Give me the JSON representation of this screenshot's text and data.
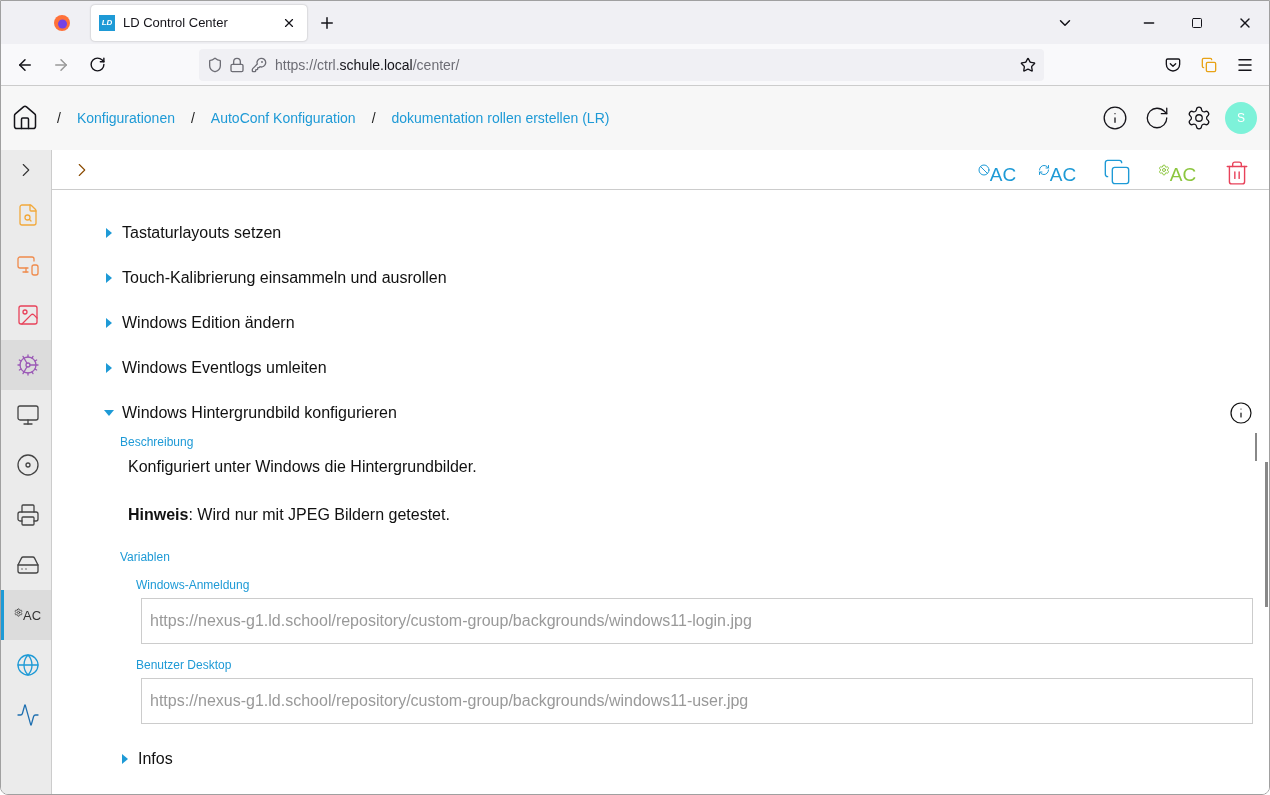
{
  "browser": {
    "tab": {
      "icon_text": "LD",
      "title": "LD Control Center"
    },
    "url": {
      "prefix": "https://ctrl.",
      "host": "schule.local",
      "path": "/center/"
    }
  },
  "breadcrumbs": [
    {
      "label": "Konfigurationen"
    },
    {
      "label": "AutoConf Konfiguration"
    },
    {
      "label": "dokumentation rollen erstellen (LR)"
    }
  ],
  "header": {
    "separator": "/",
    "avatar": "S"
  },
  "sidebar": {
    "items": [
      {
        "kind": "report",
        "selected": false,
        "highlighted": false
      },
      {
        "kind": "devices",
        "selected": false,
        "highlighted": false
      },
      {
        "kind": "image",
        "selected": false,
        "highlighted": false
      },
      {
        "kind": "settings",
        "selected": false,
        "highlighted": true
      },
      {
        "kind": "screen",
        "selected": false,
        "highlighted": false
      },
      {
        "kind": "disc",
        "selected": false,
        "highlighted": false
      },
      {
        "kind": "printer",
        "selected": false,
        "highlighted": false
      },
      {
        "kind": "drive",
        "selected": false,
        "highlighted": false
      },
      {
        "kind": "autoconf",
        "label": "AC",
        "selected": true,
        "highlighted": false
      },
      {
        "kind": "network",
        "selected": false,
        "highlighted": false
      },
      {
        "kind": "monitor",
        "selected": false,
        "highlighted": false
      }
    ]
  },
  "toolbar": [
    {
      "kind": "disable",
      "label": "AC"
    },
    {
      "kind": "reset",
      "label": "AC"
    },
    {
      "kind": "document"
    },
    {
      "kind": "configure",
      "label": "AC"
    },
    {
      "kind": "delete"
    }
  ],
  "sections": [
    {
      "title": "Tastaturlayouts setzen",
      "expanded": false
    },
    {
      "title": "Touch-Kalibrierung einsammeln und ausrollen",
      "expanded": false
    },
    {
      "title": "Windows Edition ändern",
      "expanded": false
    },
    {
      "title": "Windows Eventlogs umleiten",
      "expanded": false
    },
    {
      "title": "Windows Hintergrundbild konfigurieren",
      "expanded": true,
      "description_label": "Beschreibung",
      "description": "Konfiguriert unter Windows die Hintergrundbilder.",
      "note": "**Hinweis**: Wird nur mit JPEG Bildern getestet.",
      "variables_label": "Variablen",
      "variables": [
        {
          "label": "Windows-Anmeldung",
          "value": "https://nexus-g1.ld.school/repository/custom-group/backgrounds/windows11-login.jpg"
        },
        {
          "label": "Benutzer Desktop",
          "value": "https://nexus-g1.ld.school/repository/custom-group/backgrounds/windows11-user.jpg"
        }
      ]
    },
    {
      "title": "Infos",
      "expanded": false
    }
  ]
}
